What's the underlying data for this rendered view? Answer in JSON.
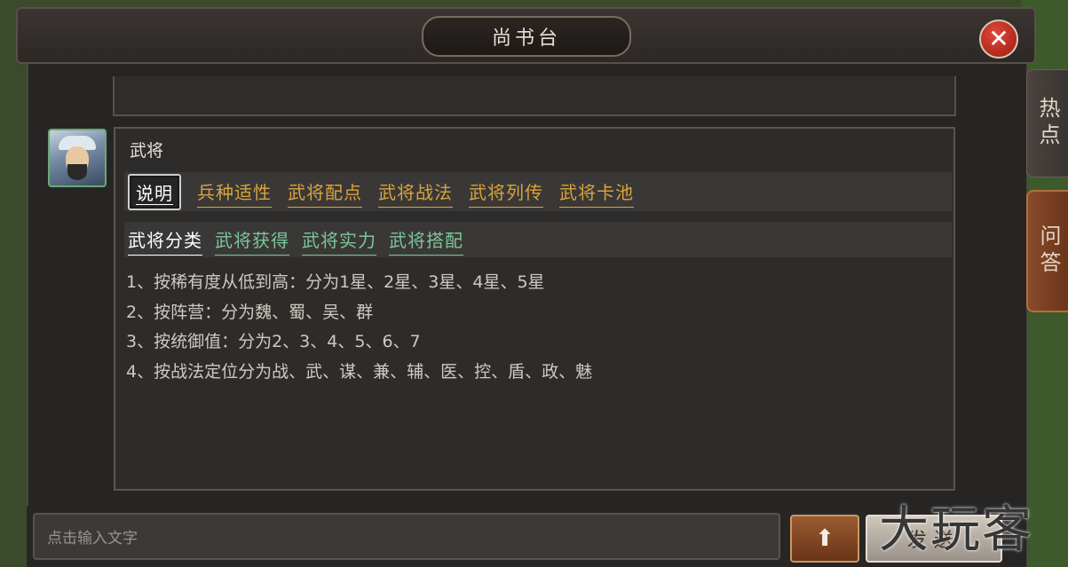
{
  "window": {
    "title": "尚书台"
  },
  "side_tabs": [
    {
      "label": "热点"
    },
    {
      "label": "问答"
    }
  ],
  "panel": {
    "header": "武将",
    "primary_tabs": [
      {
        "label": "说明",
        "color": "#ffffff",
        "selected": true
      },
      {
        "label": "兵种适性",
        "color": "#d8a43c"
      },
      {
        "label": "武将配点",
        "color": "#d8a43c"
      },
      {
        "label": "武将战法",
        "color": "#d8a43c"
      },
      {
        "label": "武将列传",
        "color": "#d8a43c"
      },
      {
        "label": "武将卡池",
        "color": "#d8a43c"
      }
    ],
    "secondary_tabs": [
      {
        "label": "武将分类",
        "color": "#ffffff"
      },
      {
        "label": "武将获得",
        "color": "#7cc79a"
      },
      {
        "label": "武将实力",
        "color": "#7cc79a"
      },
      {
        "label": "武将搭配",
        "color": "#7cc79a"
      }
    ],
    "content_lines": [
      "1、按稀有度从低到高：分为1星、2星、3星、4星、5星",
      "2、按阵营：分为魏、蜀、吴、群",
      "3、按统御值：分为2、3、4、5、6、7",
      "4、按战法定位分为战、武、谋、兼、辅、医、控、盾、政、魅"
    ]
  },
  "input": {
    "placeholder": "点击输入文字"
  },
  "buttons": {
    "up_icon": "arrow-up-icon",
    "send_label": "发送"
  },
  "watermark": "大玩客",
  "icons": {
    "close": "close-icon",
    "avatar": "general-portrait"
  }
}
